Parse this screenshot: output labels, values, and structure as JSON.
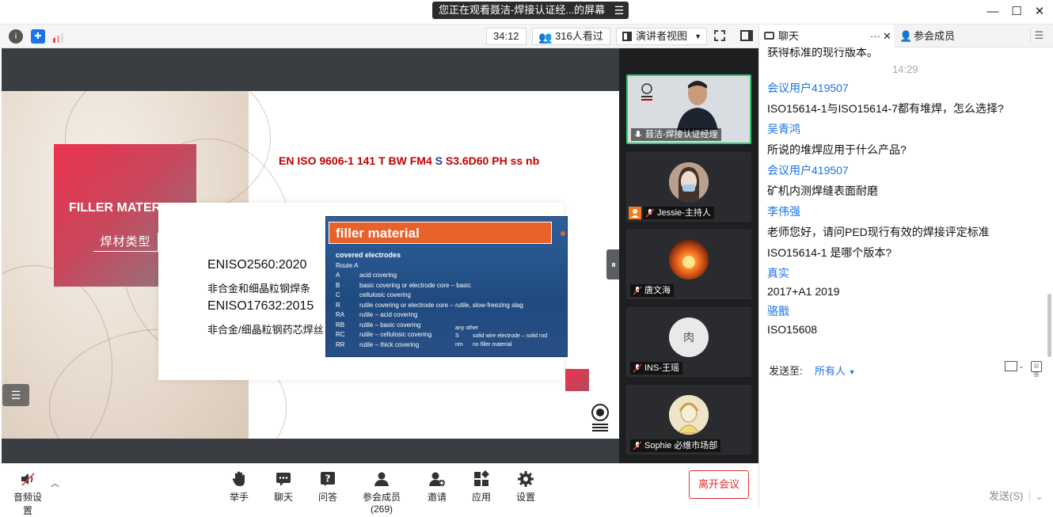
{
  "window": {
    "share_banner": "您正在观看聂洁-焊接认证经...的屏幕"
  },
  "topbar": {
    "timer": "34:12",
    "viewers": "316人看过",
    "view_mode": "演讲者视图"
  },
  "slide": {
    "filler_title": "FILLER MATERIAL",
    "filler_subtitle": "焊材类型",
    "en_code_part1": "EN ISO 9606-1 141 T BW FM4 ",
    "en_code_s": "S",
    "en_code_part2": " S3.6D60 PH ss nb",
    "standards": [
      {
        "code": "ENISO2560:2020",
        "desc": "非合金和细晶粒钢焊条"
      },
      {
        "code": "ENISO17632:2015",
        "desc": "非合金/细晶粒钢药芯焊丝"
      }
    ],
    "image": {
      "header": "filler material",
      "section": "covered electrodes",
      "route": "Route A",
      "rows": [
        {
          "code": "A",
          "text": "acid covering"
        },
        {
          "code": "B",
          "text": "basic covering or electrode core – basic"
        },
        {
          "code": "C",
          "text": "cellulosic covering"
        },
        {
          "code": "R",
          "text": "rutile covering or electrode core – rutile, slow-freezing slag"
        },
        {
          "code": "RA",
          "text": "rutile – acid covering"
        },
        {
          "code": "RB",
          "text": "rutile – basic covering"
        },
        {
          "code": "RC",
          "text": "rutile – cellulosic covering"
        },
        {
          "code": "RR",
          "text": "rutile – thick covering"
        }
      ],
      "other_title": "any other",
      "other_rows": [
        {
          "code": "S",
          "text": "solid wire electrode – solid rod"
        },
        {
          "code": "nm",
          "text": "no filler material"
        }
      ]
    }
  },
  "participants": [
    {
      "name": "聂洁-焊接认证经理",
      "avatar": "photo-man"
    },
    {
      "name": "Jessie-主持人",
      "avatar": "photo-woman"
    },
    {
      "name": "唐文海",
      "avatar": "fire"
    },
    {
      "name": "INS-王瑶",
      "avatar": "肉"
    },
    {
      "name": "Sophie 必维市场部",
      "avatar": "cartoon"
    }
  ],
  "bottombar": {
    "audio": "音频设置",
    "raise_hand": "举手",
    "chat": "聊天",
    "qa": "问答",
    "participants": "参会成员(269)",
    "invite": "邀请",
    "apps": "应用",
    "settings": "设置",
    "leave": "离开会议"
  },
  "chat": {
    "tab_chat": "聊天",
    "tab_members": "参会成员",
    "partial_top": "获得标准的现行版本。",
    "timestamp": "14:29",
    "messages": [
      {
        "user": "会议用户419507",
        "text": "ISO15614-1与ISO15614-7都有堆焊，怎么选择?"
      },
      {
        "user": "吴青鸿",
        "text": "所说的堆焊应用于什么产品?"
      },
      {
        "user": "会议用户419507",
        "text": "矿机内测焊缝表面耐磨"
      },
      {
        "user": "李伟强",
        "text": "老师您好，请问PED现行有效的焊接评定标准"
      },
      {
        "user": "",
        "text": "ISO15614-1 是哪个版本?"
      },
      {
        "user": "真实",
        "text": "2017+A1 2019"
      },
      {
        "user": "骆戬",
        "text": "ISO15608"
      }
    ],
    "send_to_label": "发送至:",
    "send_to_value": "所有人",
    "send_button": "发送(S)"
  }
}
